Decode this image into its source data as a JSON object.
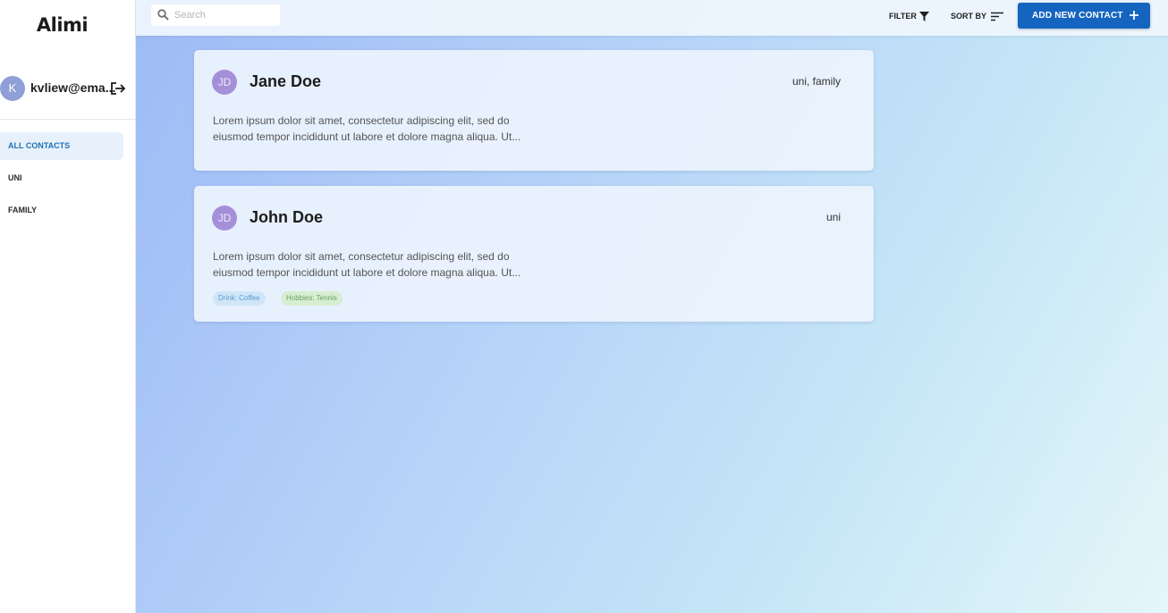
{
  "sidebar": {
    "brand": "Alimi",
    "user": {
      "avatar_initial": "K",
      "email": "kvliew@ema..."
    },
    "nav": [
      {
        "label": "ALL CONTACTS",
        "active": true
      },
      {
        "label": "UNI",
        "active": false
      },
      {
        "label": "FAMILY",
        "active": false
      }
    ]
  },
  "topbar": {
    "search": {
      "placeholder": "Search",
      "value": ""
    },
    "filter_label": "FILTER",
    "sort_label": "SORT BY",
    "add_label": "ADD NEW CONTACT"
  },
  "contacts": [
    {
      "initials": "JD",
      "name": "Jane Doe",
      "groups": "uni, family",
      "description": "Lorem ipsum dolor sit amet, consectetur adipiscing elit, sed do eiusmod tempor incididunt ut labore et dolore magna aliqua. Ut...",
      "chips": []
    },
    {
      "initials": "JD",
      "name": "John Doe",
      "groups": "uni",
      "description": "Lorem ipsum dolor sit amet, consectetur adipiscing elit, sed do eiusmod tempor incididunt ut labore et dolore magna aliqua. Ut...",
      "chips": [
        {
          "label": "Drink: Coffee",
          "bg": "#cfe6f7",
          "fg": "#5a9bd0"
        },
        {
          "label": "Hobbies: Tennis",
          "bg": "#d7edd2",
          "fg": "#6aa35f"
        }
      ]
    }
  ],
  "colors": {
    "accent": "#1565c0",
    "avatar": "#a48fd9",
    "active_nav_bg": "#e7f1fb"
  }
}
